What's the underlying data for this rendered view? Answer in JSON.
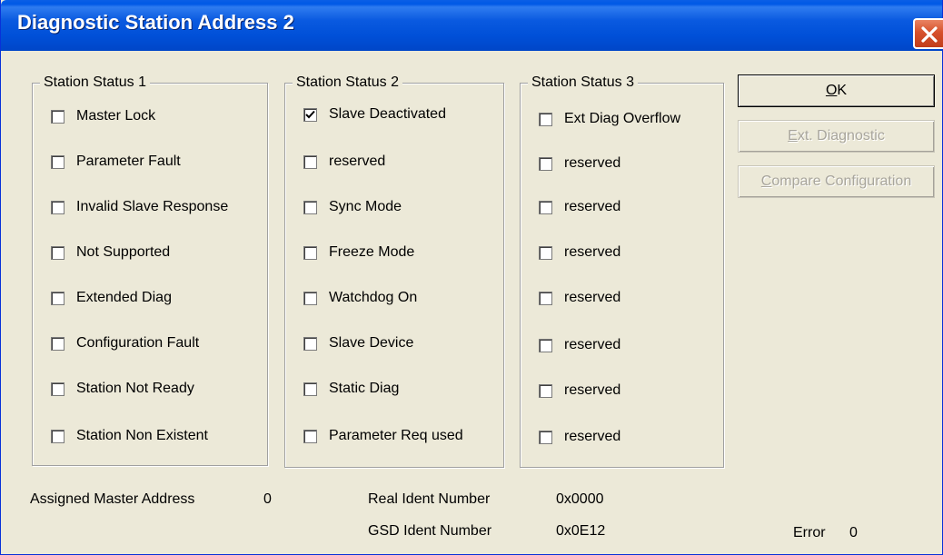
{
  "window": {
    "title": "Diagnostic Station Address 2"
  },
  "groups": [
    {
      "label": "Station Status 1",
      "items": [
        {
          "label": "Master Lock",
          "checked": false
        },
        {
          "label": "Parameter Fault",
          "checked": false
        },
        {
          "label": "Invalid Slave Response",
          "checked": false
        },
        {
          "label": "Not Supported",
          "checked": false
        },
        {
          "label": "Extended Diag",
          "checked": false
        },
        {
          "label": "Configuration Fault",
          "checked": false
        },
        {
          "label": "Station Not Ready",
          "checked": false
        },
        {
          "label": "Station Non Existent",
          "checked": false
        }
      ]
    },
    {
      "label": "Station Status 2",
      "items": [
        {
          "label": "Slave Deactivated",
          "checked": true
        },
        {
          "label": "reserved",
          "checked": false
        },
        {
          "label": "Sync Mode",
          "checked": false
        },
        {
          "label": "Freeze Mode",
          "checked": false
        },
        {
          "label": "Watchdog On",
          "checked": false
        },
        {
          "label": "Slave Device",
          "checked": false
        },
        {
          "label": "Static Diag",
          "checked": false
        },
        {
          "label": "Parameter Req used",
          "checked": false
        }
      ]
    },
    {
      "label": "Station Status 3",
      "items": [
        {
          "label": "Ext Diag Overflow",
          "checked": false
        },
        {
          "label": "reserved",
          "checked": false
        },
        {
          "label": "reserved",
          "checked": false
        },
        {
          "label": "reserved",
          "checked": false
        },
        {
          "label": "reserved",
          "checked": false
        },
        {
          "label": "reserved",
          "checked": false
        },
        {
          "label": "reserved",
          "checked": false
        },
        {
          "label": "reserved",
          "checked": false
        }
      ]
    }
  ],
  "buttons": {
    "ok": {
      "mnemonic": "O",
      "rest": "K",
      "enabled": true
    },
    "ext_diag": {
      "mnemonic": "E",
      "rest": "xt. Diagnostic",
      "enabled": false
    },
    "compare": {
      "mnemonic": "C",
      "rest": "ompare Configuration",
      "enabled": false
    }
  },
  "info": {
    "master_label": "Assigned Master Address",
    "master_value": "0",
    "real_label": "Real Ident Number",
    "real_value": "0x0000",
    "gsd_label": "GSD Ident Number",
    "gsd_value": "0x0E12",
    "error_label": "Error",
    "error_value": "0"
  },
  "icons": {
    "close": "close-icon",
    "check": "checkmark-icon"
  },
  "colors": {
    "titlebar": "#0054e3",
    "dialog_bg": "#ece9d8",
    "close_button": "#d6512c"
  }
}
